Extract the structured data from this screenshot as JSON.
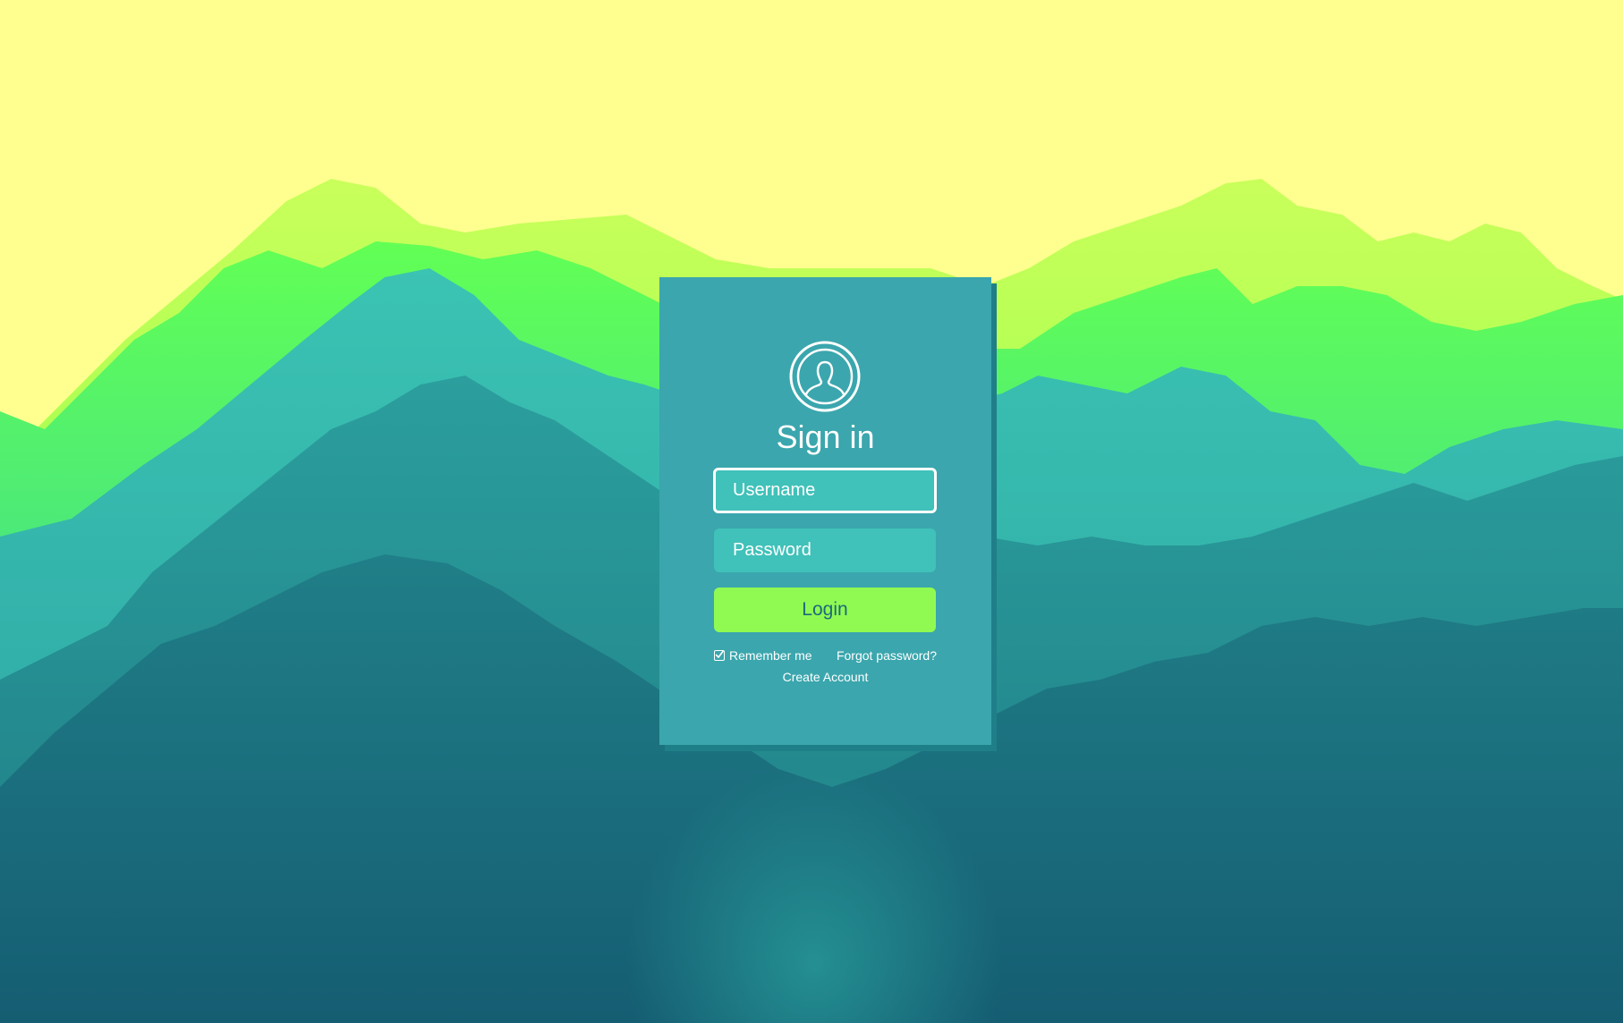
{
  "login_form": {
    "title": "Sign in",
    "avatar_icon": "user-circle-icon",
    "username": {
      "placeholder": "Username",
      "value": ""
    },
    "password": {
      "placeholder": "Password",
      "value": ""
    },
    "login_label": "Login",
    "remember_label": "Remember me",
    "remember_checked": true,
    "forgot_label": "Forgot password?",
    "create_label": "Create Account"
  },
  "colors": {
    "sky": "#ffff8f",
    "card": "#3ba6ad",
    "field": "#40c1b9",
    "button": "#90fa52",
    "button_text": "#1b6a7c"
  }
}
